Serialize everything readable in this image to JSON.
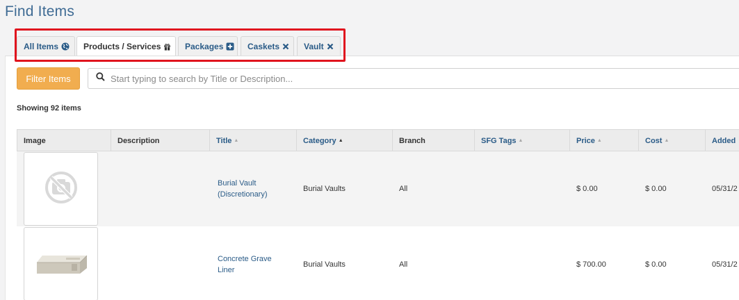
{
  "page": {
    "title": "Find Items"
  },
  "tabs": [
    {
      "label": "All Items",
      "icon": "globe-icon"
    },
    {
      "label": "Products / Services",
      "icon": "gift-icon"
    },
    {
      "label": "Packages",
      "icon": "plus-square-icon"
    },
    {
      "label": "Caskets",
      "icon": "x-icon"
    },
    {
      "label": "Vault",
      "icon": "x-icon"
    }
  ],
  "toolbar": {
    "filter_label": "Filter Items",
    "search_placeholder": "Start typing to search by Title or Description..."
  },
  "summary": {
    "text": "Showing 92 items"
  },
  "table": {
    "columns": [
      "Image",
      "Description",
      "Title",
      "Category",
      "Branch",
      "SFG Tags",
      "Price",
      "Cost",
      "Added"
    ],
    "rows": [
      {
        "image": "no-image-placeholder",
        "description": "",
        "title": "Burial Vault (Discretionary)",
        "category": "Burial Vaults",
        "branch": "All",
        "sfg_tags": "",
        "price": "$ 0.00",
        "cost": "$ 0.00",
        "added": "05/31/2"
      },
      {
        "image": "grave-liner-photo",
        "description": "",
        "title": "Concrete Grave Liner",
        "category": "Burial Vaults",
        "branch": "All",
        "sfg_tags": "",
        "price": "$ 700.00",
        "cost": "$ 0.00",
        "added": "05/31/2"
      }
    ]
  },
  "colors": {
    "accent": "#2a5b87",
    "title": "#3f6b94",
    "filter_button": "#f1ad4f",
    "highlight": "#e0141e"
  }
}
